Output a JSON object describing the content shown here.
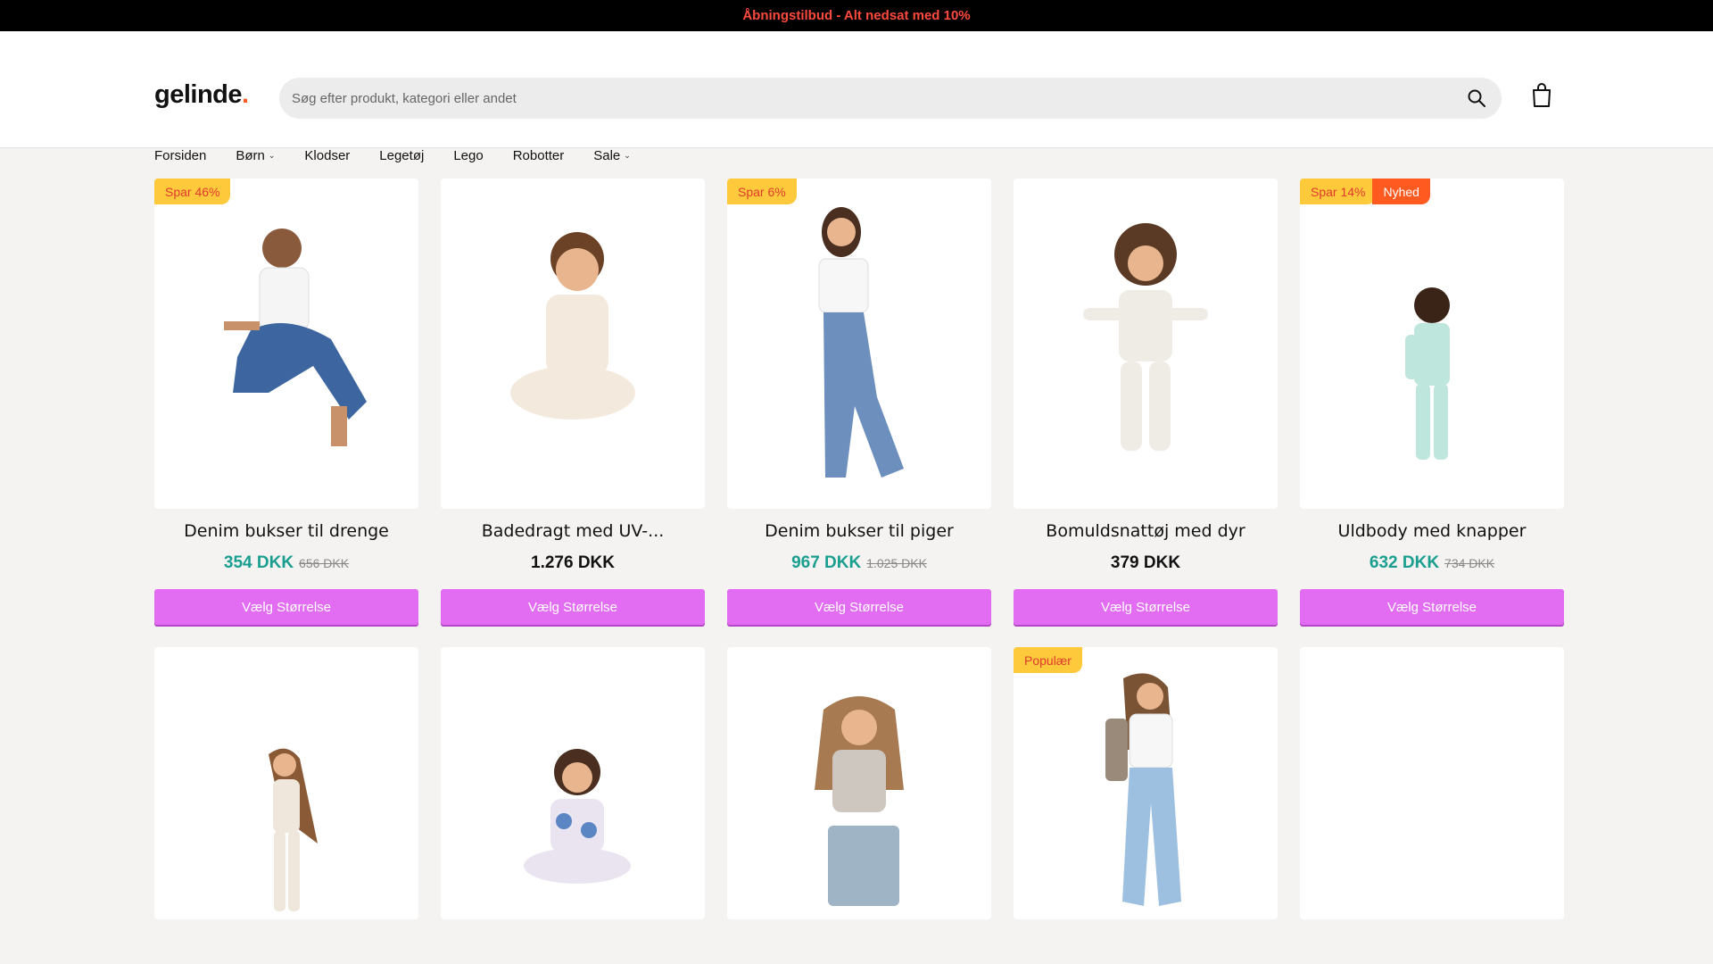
{
  "announcement": "Åbningstilbud - Alt nedsat med 10%",
  "brand": {
    "name": "gelinde",
    "dot": "."
  },
  "search": {
    "placeholder": "Søg efter produkt, kategori eller andet"
  },
  "nav": [
    {
      "label": "Forsiden",
      "dropdown": false
    },
    {
      "label": "Børn",
      "dropdown": true
    },
    {
      "label": "Klodser",
      "dropdown": false
    },
    {
      "label": "Legetøj",
      "dropdown": false
    },
    {
      "label": "Lego",
      "dropdown": false
    },
    {
      "label": "Robotter",
      "dropdown": false
    },
    {
      "label": "Sale",
      "dropdown": true
    }
  ],
  "products": [
    {
      "title": "Denim bukser til drenge",
      "price": "354 DKK",
      "old_price": "656 DKK",
      "badges": [
        "Spar 46%"
      ],
      "cta": "Vælg Størrelse"
    },
    {
      "title": "Badedragt med UV-...",
      "price": "1.276 DKK",
      "old_price": "",
      "badges": [],
      "cta": "Vælg Størrelse"
    },
    {
      "title": "Denim bukser til piger",
      "price": "967 DKK",
      "old_price": "1.025 DKK",
      "badges": [
        "Spar 6%"
      ],
      "cta": "Vælg Størrelse"
    },
    {
      "title": "Bomuldsnattøj med dyr",
      "price": "379 DKK",
      "old_price": "",
      "badges": [],
      "cta": "Vælg Størrelse"
    },
    {
      "title": "Uldbody med knapper",
      "price": "632 DKK",
      "old_price": "734 DKK",
      "badges": [
        "Spar 14%",
        "Nyhed"
      ],
      "cta": "Vælg Størrelse"
    }
  ],
  "products_row2": [
    {
      "badges": []
    },
    {
      "badges": []
    },
    {
      "badges": []
    },
    {
      "badges": [
        "Populær"
      ]
    },
    {
      "badges": []
    }
  ],
  "colors": {
    "accent_button": "#e26cf2",
    "sale_price": "#1a9e8f",
    "badge_yellow": "#ffc93c",
    "badge_orange": "#ff5a1f",
    "announcement_text": "#ff4a3d"
  }
}
